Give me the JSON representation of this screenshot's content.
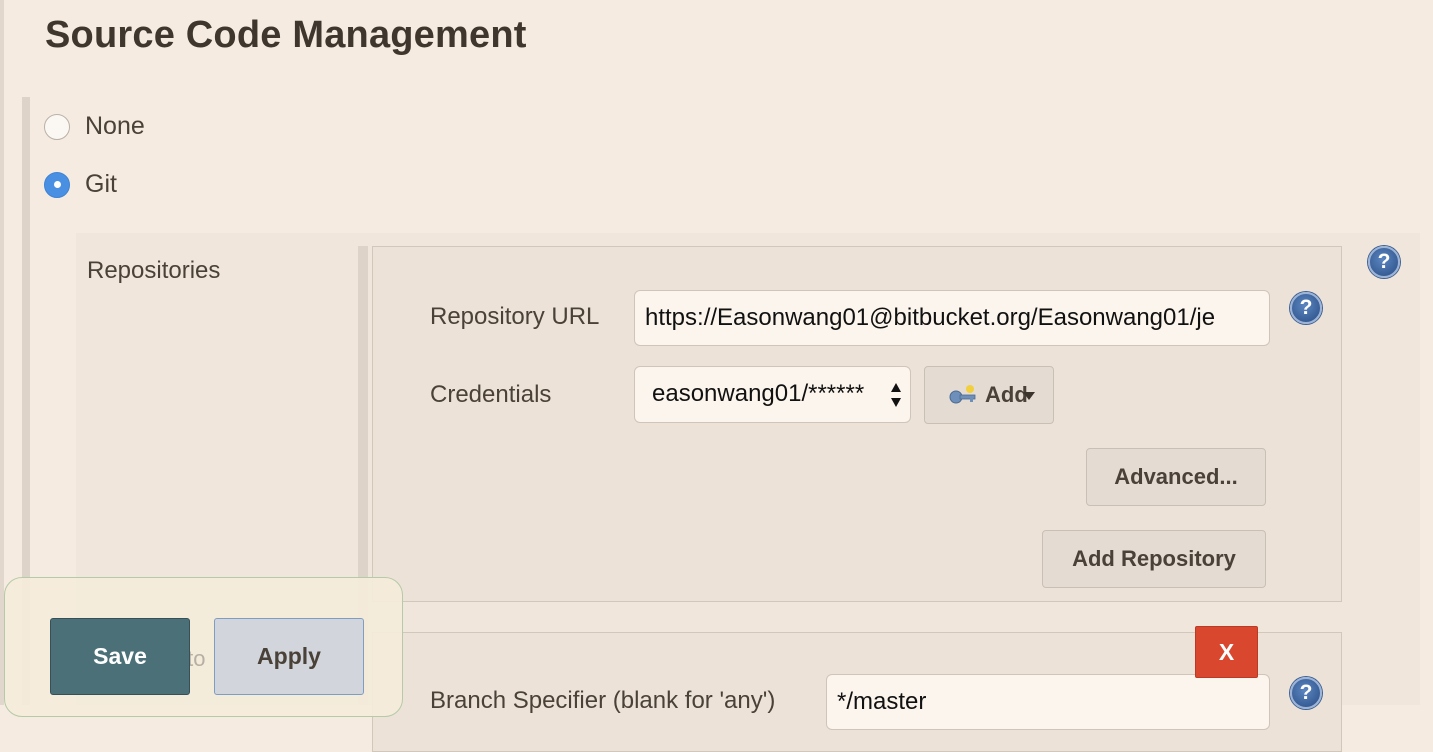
{
  "section": {
    "title": "Source Code Management"
  },
  "scm_options": [
    {
      "label": "None",
      "checked": false
    },
    {
      "label": "Git",
      "checked": true
    }
  ],
  "git": {
    "repositories_label": "Repositories",
    "repository_url": {
      "label": "Repository URL",
      "value": "https://Easonwang01@bitbucket.org/Easonwang01/je"
    },
    "credentials": {
      "label": "Credentials",
      "selected": "easonwang01/******",
      "add_label": "Add"
    },
    "advanced_label": "Advanced...",
    "add_repository_label": "Add Repository",
    "delete_label": "X",
    "branch": {
      "label": "Branch Specifier (blank for 'any')",
      "value": "*/master"
    },
    "help_icon_glyph": "?"
  },
  "footer": {
    "obscured_text": "s to",
    "save_label": "Save",
    "apply_label": "Apply"
  },
  "colors": {
    "page_bg": "#f5ebe1",
    "save_bg": "#4b7078",
    "delete_bg": "#d9472f",
    "radio_checked": "#4a90e2",
    "help_icon": "#2a4d85"
  },
  "icons": {
    "help": "help-icon",
    "credentials_add": "key-icon",
    "add_dropdown": "dropdown-caret-icon"
  }
}
